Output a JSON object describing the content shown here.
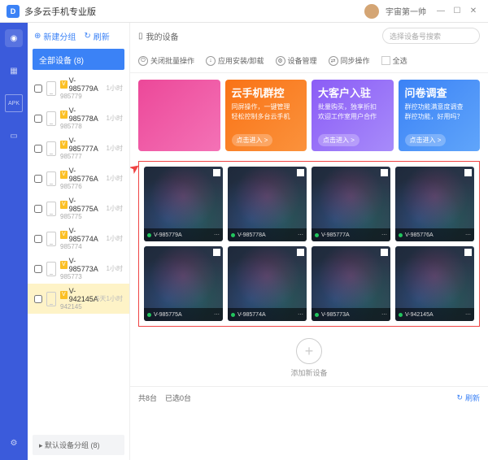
{
  "titlebar": {
    "app_title": "多多云手机专业版",
    "user_name": "宇宙第一帅"
  },
  "sidebar": {
    "new_group": "新建分组",
    "refresh": "刷新",
    "all_devices": "全部设备 (8)",
    "default_group": "默认设备分组 (8)",
    "devices": [
      {
        "badge": "V",
        "name": "V-985779A",
        "id": "985779",
        "time": "1小时"
      },
      {
        "badge": "V",
        "name": "V-985778A",
        "id": "985778",
        "time": "1小时"
      },
      {
        "badge": "V",
        "name": "V-985777A",
        "id": "985777",
        "time": "1小时"
      },
      {
        "badge": "V",
        "name": "V-985776A",
        "id": "985776",
        "time": "1小时"
      },
      {
        "badge": "V",
        "name": "V-985775A",
        "id": "985775",
        "time": "1小时"
      },
      {
        "badge": "V",
        "name": "V-985774A",
        "id": "985774",
        "time": "1小时"
      },
      {
        "badge": "V",
        "name": "V-985773A",
        "id": "985773",
        "time": "1小时"
      },
      {
        "badge": "V",
        "name": "V-942145A",
        "id": "942145",
        "time": "5天1小时"
      }
    ]
  },
  "content": {
    "my_devices": "我的设备",
    "search_placeholder": "选择设备号搜索",
    "toolbar": {
      "close_batch": "关闭批量操作",
      "app_install": "应用安装/卸载",
      "device_mgmt": "设备管理",
      "sync_op": "同步操作",
      "select_all": "全选"
    },
    "promos": [
      {
        "title": "",
        "sub": "",
        "btn": ""
      },
      {
        "title": "云手机群控",
        "sub": "同屏操作，一键管理\n轻松控制多台云手机",
        "btn": "点击进入 >"
      },
      {
        "title": "大客户入驻",
        "sub": "批量购买，独享折扣\n欢迎工作室用户合作",
        "btn": "点击进入 >"
      },
      {
        "title": "问卷调查",
        "sub": "群控功能满意度调查\n群控功能，好用吗？",
        "btn": "点击进入 >"
      }
    ],
    "tiles": [
      {
        "name": "V-985779A"
      },
      {
        "name": "V-985778A"
      },
      {
        "name": "V-985777A"
      },
      {
        "name": "V-985776A"
      },
      {
        "name": "V-985775A"
      },
      {
        "name": "V-985774A"
      },
      {
        "name": "V-985773A"
      },
      {
        "name": "V-942145A"
      }
    ],
    "add_device": "添加新设备",
    "footer": {
      "total": "共8台",
      "selected": "已选0台",
      "refresh": "刷新"
    }
  }
}
